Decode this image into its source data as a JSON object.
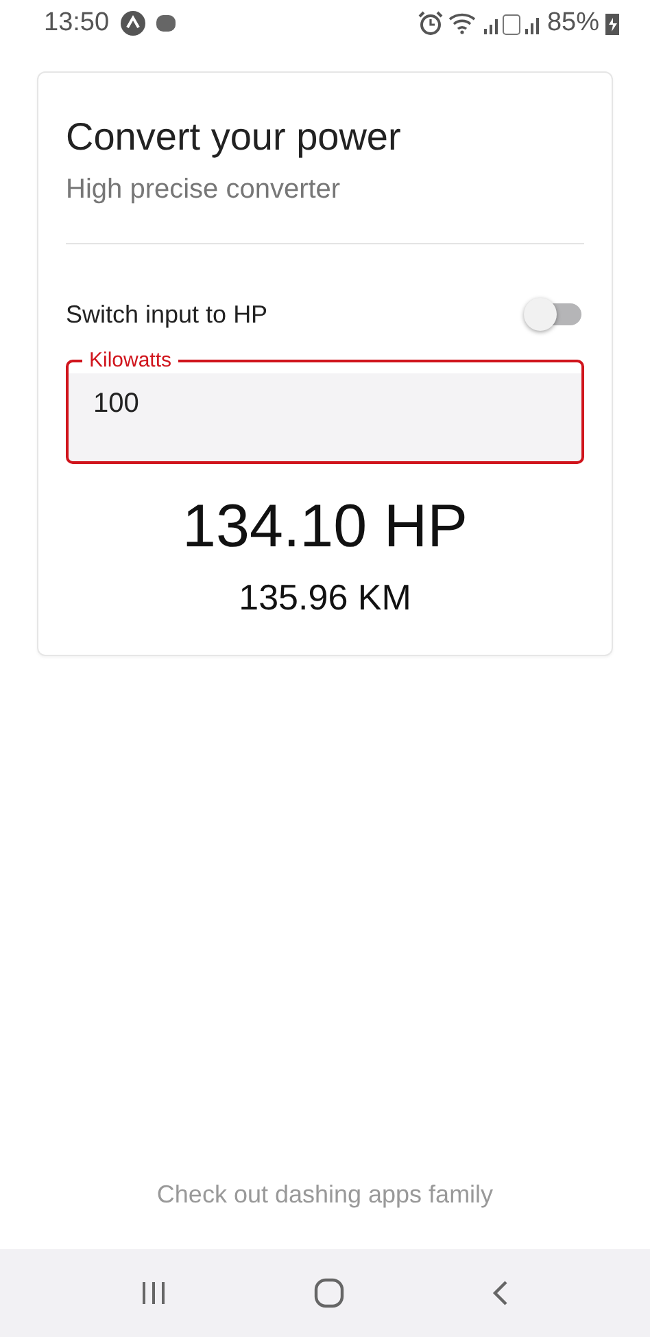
{
  "status_bar": {
    "time": "13:50",
    "battery": "85%"
  },
  "card": {
    "title": "Convert your power",
    "subtitle": "High precise converter",
    "switch": {
      "label": "Switch input to HP",
      "on": false
    },
    "field": {
      "label": "Kilowatts",
      "value": "100",
      "focused": true
    },
    "result_primary": "134.10 HP",
    "result_secondary": "135.96 KM"
  },
  "footer_link": "Check out dashing apps family"
}
